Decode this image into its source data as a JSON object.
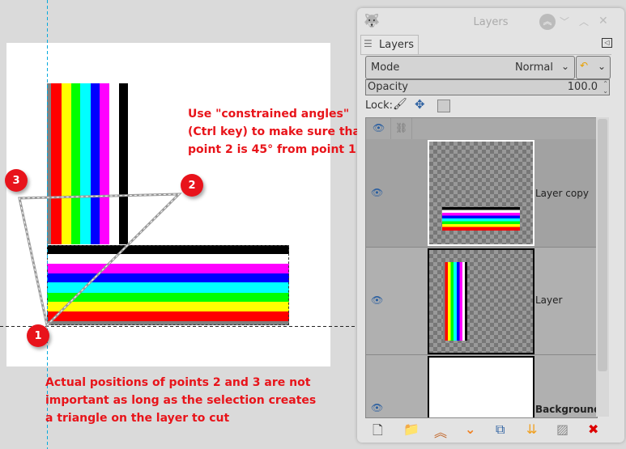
{
  "annotations": {
    "note_top": [
      "Use \"constrained angles\"",
      "(Ctrl key) to make sure that",
      "point 2 is 45° from point 1"
    ],
    "note_bottom": [
      "Actual positions of points 2 and 3 are not",
      "important as long as the selection creates",
      "a triangle on the layer to cut"
    ],
    "markers": [
      "1",
      "2",
      "3"
    ]
  },
  "colors": {
    "accent": "#e8141a",
    "guide": "#00aadd"
  },
  "panel": {
    "title": "Layers",
    "tab_label": "Layers",
    "mode_label": "Mode",
    "mode_value": "Normal",
    "opacity_label": "Opacity",
    "opacity_value": "100.0",
    "lock_label": "Lock:",
    "layers": [
      {
        "name": "Layer copy"
      },
      {
        "name": "Layer"
      },
      {
        "name": "Background"
      }
    ]
  }
}
